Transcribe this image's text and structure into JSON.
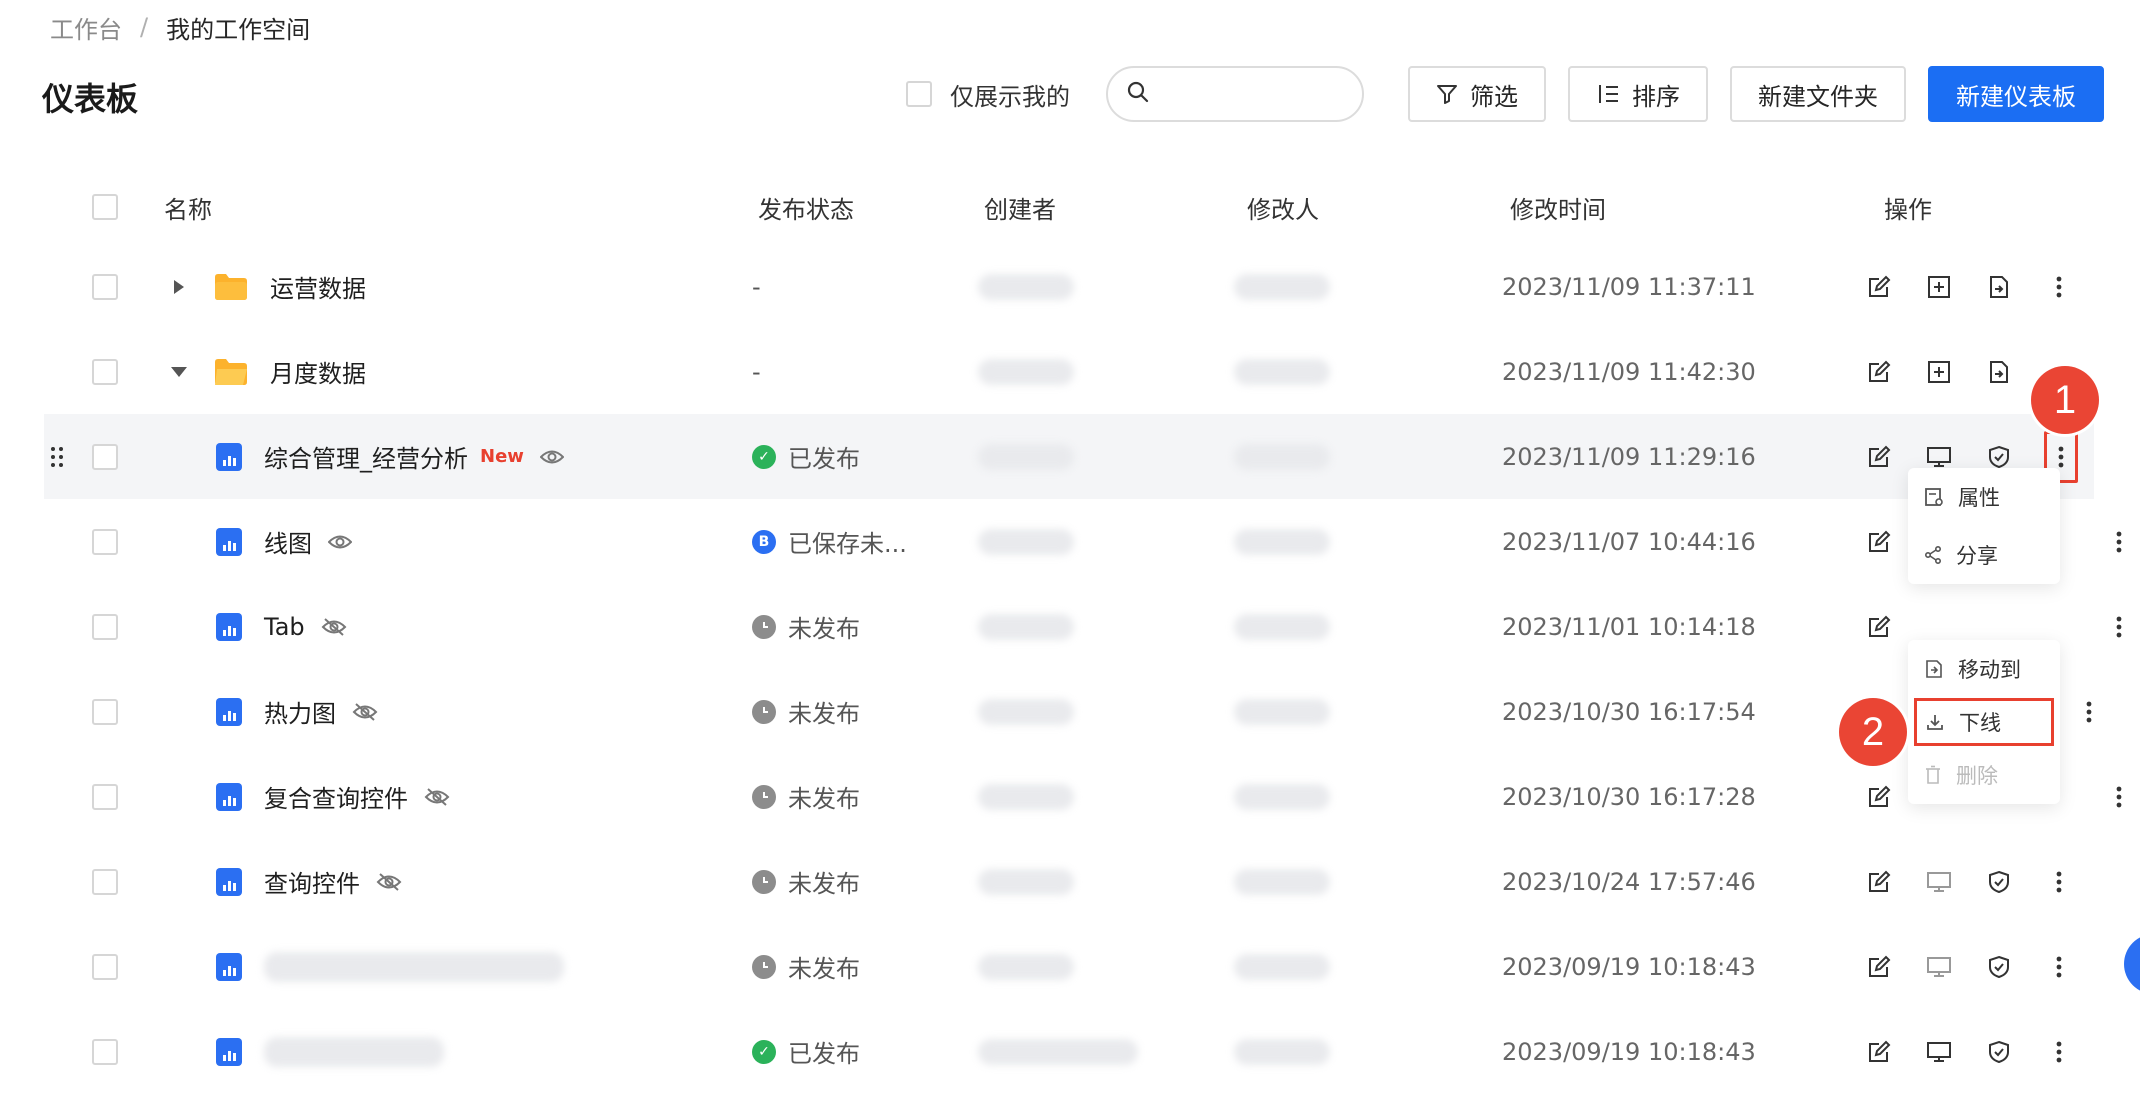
{
  "breadcrumb": {
    "root": "工作台",
    "separator": "/",
    "current": "我的工作空间"
  },
  "page": {
    "title": "仪表板"
  },
  "toolbar": {
    "only_mine_label": "仅展示我的",
    "search_placeholder": "",
    "filter_label": "筛选",
    "sort_label": "排序",
    "new_folder_label": "新建文件夹",
    "new_dashboard_label": "新建仪表板",
    "primary_color": "#1b6ef3"
  },
  "table": {
    "columns": {
      "name": "名称",
      "status": "发布状态",
      "creator": "创建者",
      "modifier": "修改人",
      "time": "修改时间",
      "ops": "操作"
    },
    "rows": [
      {
        "name": "运营数据",
        "status": "-",
        "time": "2023/11/09 11:37:11"
      },
      {
        "name": "月度数据",
        "status": "-",
        "time": "2023/11/09 11:42:30"
      },
      {
        "name": "综合管理_经营分析",
        "badge": "New",
        "status": "已发布",
        "time": "2023/11/09 11:29:16"
      },
      {
        "name": "线图",
        "status": "已保存未...",
        "time": "2023/11/07 10:44:16"
      },
      {
        "name": "Tab",
        "status": "未发布",
        "time": "2023/11/01 10:14:18"
      },
      {
        "name": "热力图",
        "status": "未发布",
        "time": "2023/10/30 16:17:54"
      },
      {
        "name": "复合查询控件",
        "status": "未发布",
        "time": "2023/10/30 16:17:28"
      },
      {
        "name": "查询控件",
        "status": "未发布",
        "time": "2023/10/24 17:57:46"
      },
      {
        "name": "",
        "status": "未发布",
        "time": "2023/09/19 10:18:43"
      },
      {
        "name": "",
        "status": "已发布",
        "time": "2023/09/19 10:18:43"
      }
    ]
  },
  "menu": {
    "items": [
      "属性",
      "分享",
      "移动到",
      "下线",
      "删除"
    ]
  },
  "steps": [
    "1",
    "2"
  ]
}
